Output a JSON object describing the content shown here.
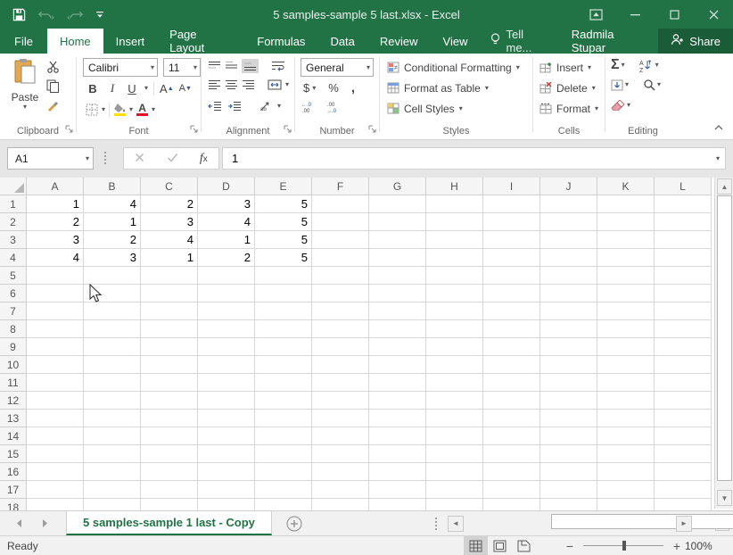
{
  "titlebar": {
    "title": "5 samples-sample 5 last.xlsx - Excel"
  },
  "tabs": {
    "file": "File",
    "items": [
      {
        "label": "Home"
      },
      {
        "label": "Insert"
      },
      {
        "label": "Page Layout"
      },
      {
        "label": "Formulas"
      },
      {
        "label": "Data"
      },
      {
        "label": "Review"
      },
      {
        "label": "View"
      }
    ],
    "active": "Home",
    "tell_me": "Tell me...",
    "user": "Radmila Stupar",
    "share": "Share"
  },
  "ribbon": {
    "clipboard": {
      "label": "Clipboard",
      "paste": "Paste"
    },
    "font": {
      "label": "Font",
      "font_name": "Calibri",
      "font_size": "11",
      "bold": "B",
      "italic": "I",
      "underline": "U"
    },
    "alignment": {
      "label": "Alignment"
    },
    "number": {
      "label": "Number",
      "format": "General",
      "currency": "$",
      "percent": "%",
      "comma": ","
    },
    "styles": {
      "label": "Styles",
      "conditional": "Conditional Formatting",
      "format_table": "Format as Table",
      "cell_styles": "Cell Styles"
    },
    "cells": {
      "label": "Cells",
      "insert": "Insert",
      "delete": "Delete",
      "format": "Format"
    },
    "editing": {
      "label": "Editing",
      "autosum": "Σ"
    }
  },
  "formula": {
    "name_box": "A1",
    "fx": "x",
    "value": "1"
  },
  "grid": {
    "columns": [
      "A",
      "B",
      "C",
      "D",
      "E",
      "F",
      "G",
      "H",
      "I",
      "J",
      "K",
      "L"
    ],
    "row_count": 18,
    "values": [
      [
        1,
        4,
        2,
        3,
        5
      ],
      [
        2,
        1,
        3,
        4,
        5
      ],
      [
        3,
        2,
        4,
        1,
        5
      ],
      [
        4,
        3,
        1,
        2,
        5
      ]
    ]
  },
  "sheet": {
    "active_tab": "5 samples-sample 1 last - Copy"
  },
  "status": {
    "ready": "Ready",
    "zoom": "100%"
  },
  "colors": {
    "brand_green": "#217346",
    "share_green": "#1a5c38",
    "fill_yellow": "#ffe100",
    "font_red": "#e81123"
  }
}
